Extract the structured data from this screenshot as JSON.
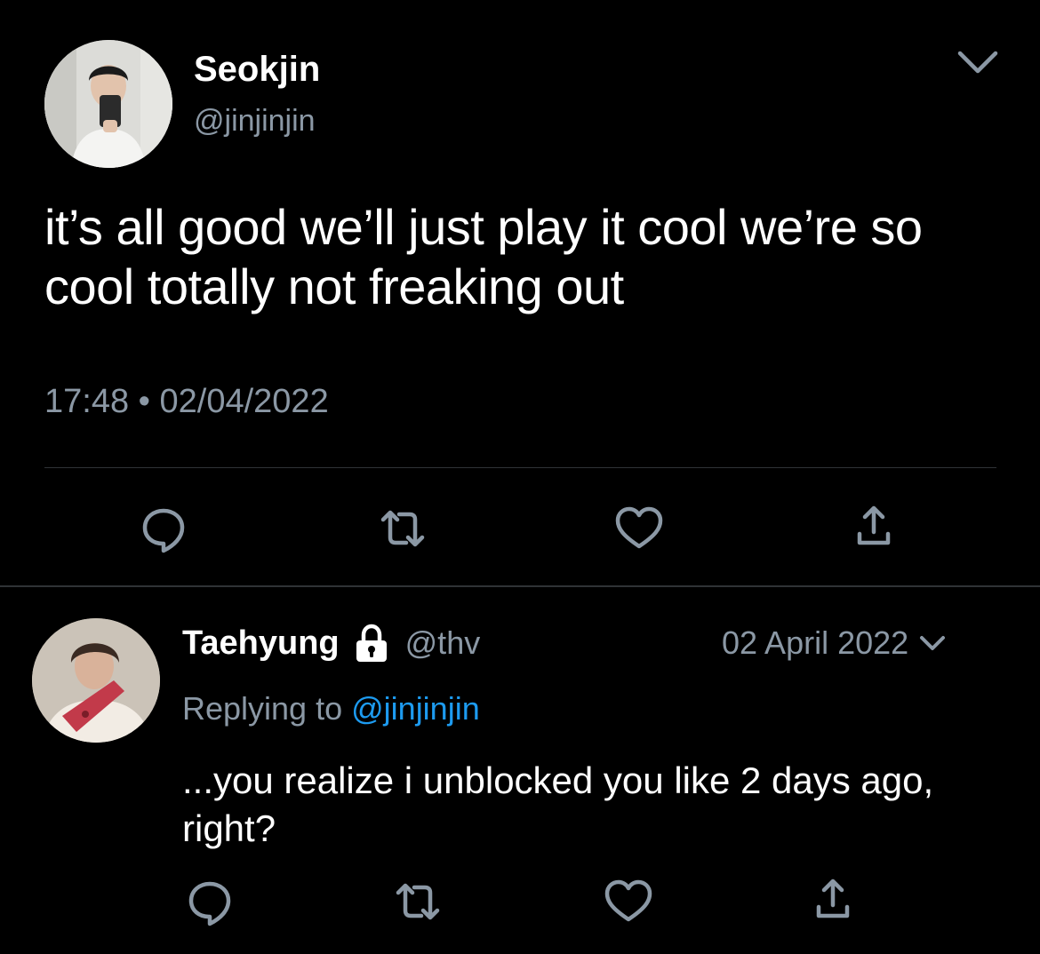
{
  "main_tweet": {
    "display_name": "Seokjin",
    "handle": "@jinjinjin",
    "text": "it’s all good we’ll just play it cool we’re so cool totally not freaking out",
    "timestamp": "17:48 • 02/04/2022"
  },
  "reply_tweet": {
    "display_name": "Taehyung",
    "handle": "@thv",
    "date": "02 April 2022",
    "replying_prefix": "Replying to",
    "replying_to": "@jinjinjin",
    "text": "...you realize i unblocked you like 2 days ago, right?"
  },
  "icons": {
    "menu": "chevron-down-icon",
    "protected": "lock-icon",
    "reply": "reply-icon",
    "retweet": "retweet-icon",
    "like": "like-icon",
    "share": "share-icon"
  },
  "colors": {
    "background": "#000000",
    "primary_text": "#ffffff",
    "secondary_text": "#8b98a5",
    "link": "#1d9bf0",
    "divider": "#2f3336"
  }
}
